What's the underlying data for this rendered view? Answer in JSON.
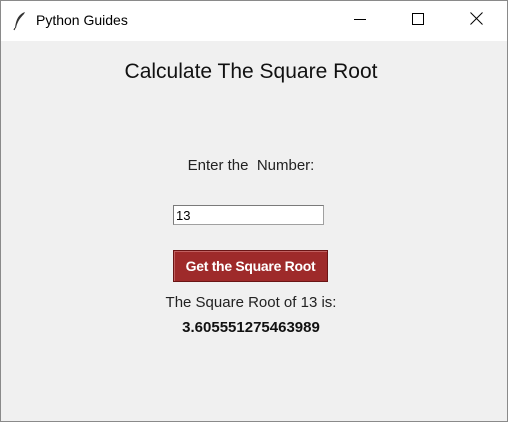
{
  "window": {
    "title": "Python Guides",
    "app_icon": "feather-icon",
    "controls": {
      "minimize_icon": "minimize-icon",
      "maximize_icon": "maximize-icon",
      "close_icon": "close-icon"
    }
  },
  "main": {
    "heading": "Calculate The Square Root",
    "prompt_label": "Enter the  Number:",
    "number_input_value": "13",
    "button_label": "Get the Square Root",
    "result_label": "The Square Root of 13 is:",
    "result_value": "3.605551275463989"
  },
  "colors": {
    "button_bg": "#9e2a2a",
    "button_text": "#ffffff",
    "window_bg": "#f0f0f0",
    "titlebar_bg": "#ffffff"
  }
}
